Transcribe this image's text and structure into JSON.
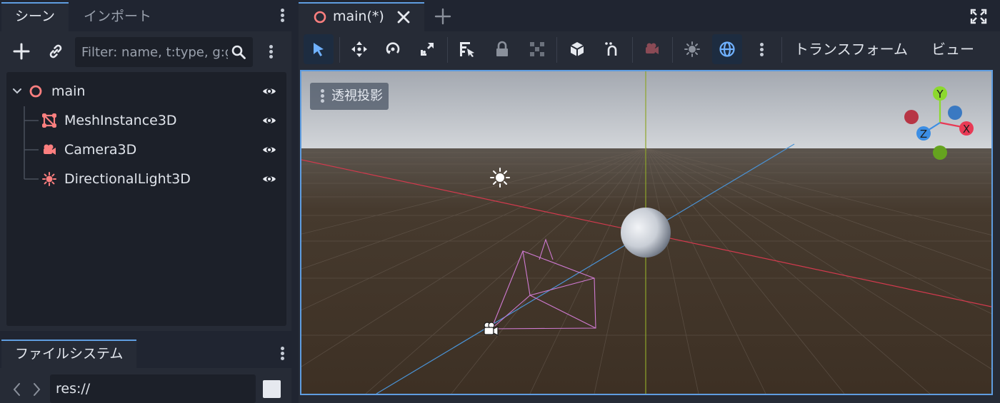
{
  "left_dock": {
    "tabs": [
      {
        "label": "シーン",
        "active": true
      },
      {
        "label": "インポート",
        "active": false
      }
    ],
    "filter": {
      "placeholder": "Filter: name, t:type, g:group"
    },
    "tree": [
      {
        "label": "main",
        "icon": "node3d-ring-icon",
        "depth": 0,
        "expanded": true
      },
      {
        "label": "MeshInstance3D",
        "icon": "mesh-instance-icon",
        "depth": 1
      },
      {
        "label": "Camera3D",
        "icon": "camera-icon",
        "depth": 1
      },
      {
        "label": "DirectionalLight3D",
        "icon": "sun-light-icon",
        "depth": 1
      }
    ],
    "filesystem": {
      "tab_label": "ファイルシステム",
      "path": "res://"
    }
  },
  "main": {
    "scene_tab": {
      "label": "main(*)"
    },
    "toolbar": {
      "transform_menu": "トランスフォーム",
      "view_menu": "ビュー",
      "active_tools": [
        "select",
        "environment"
      ]
    },
    "viewport": {
      "perspective_label": "透視投影",
      "gizmo": {
        "x": "X",
        "y": "Y",
        "z": "Z"
      }
    }
  },
  "colors": {
    "accent": "#5f9de0",
    "node_icon": "#fc7f7f",
    "axis_x": "#e83a55",
    "axis_y": "#8cd92d",
    "axis_z": "#3c8ee4",
    "ground": "#3f3226",
    "sky": "#c8cbd1"
  }
}
